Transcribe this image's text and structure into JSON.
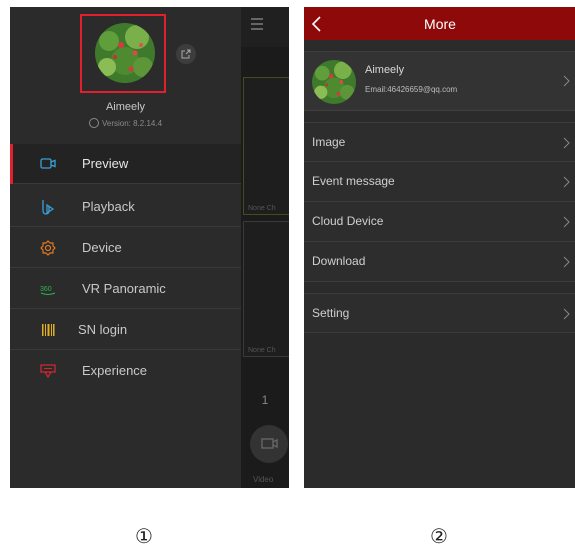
{
  "screen1": {
    "username": "Aimeely",
    "version": "Version: 8.2.14.4",
    "menu": [
      {
        "label": "Preview",
        "icon": "camera-icon",
        "color": "#3aa0d8",
        "active": true
      },
      {
        "label": "Playback",
        "icon": "playback-icon",
        "color": "#3aa0d8"
      },
      {
        "label": "Device",
        "icon": "gear-icon",
        "color": "#e07a20"
      },
      {
        "label": "VR Panoramic",
        "icon": "vr-360-icon",
        "color": "#2fb34a"
      },
      {
        "label": "SN login",
        "icon": "barcode-icon",
        "color": "#e0b020"
      },
      {
        "label": "Experience",
        "icon": "experience-icon",
        "color": "#d8282e"
      }
    ],
    "behind": {
      "page": "1",
      "video": "Video"
    }
  },
  "screen2": {
    "title": "More",
    "profile": {
      "name": "Aimeely",
      "email": "Email:46426659@qq.com"
    },
    "rows": [
      "Image",
      "Event message",
      "Cloud Device",
      "Download",
      "Setting"
    ]
  },
  "labels": [
    "①",
    "②"
  ],
  "colors": {
    "accent": "#e0212d",
    "header": "#8e0a0a",
    "background": "#2b2b2b"
  }
}
